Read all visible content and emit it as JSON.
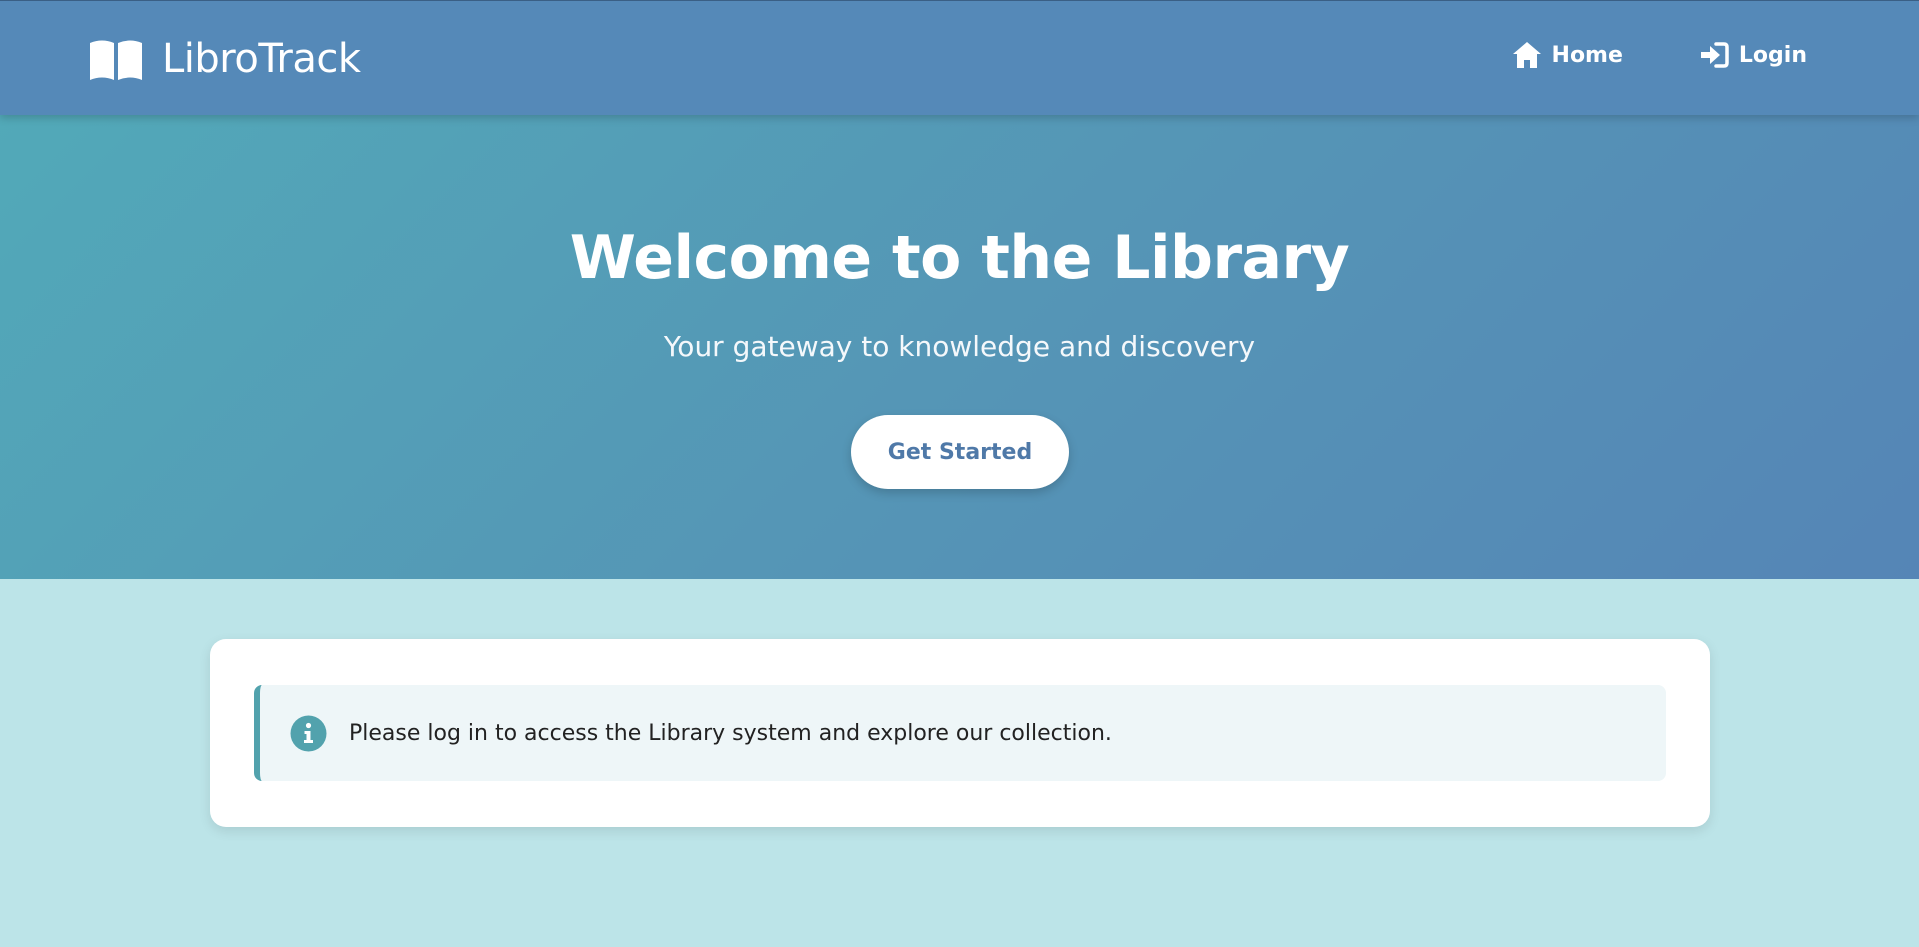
{
  "colors": {
    "navbar": "#5589b8",
    "hero_start": "#52a9b8",
    "hero_end": "#5585b6",
    "page_bg": "#bce4e8",
    "accent": "#52a2ad",
    "button_text": "#4f79a8"
  },
  "navbar": {
    "brand": {
      "icon": "open-book-icon",
      "name": "LibroTrack"
    },
    "links": [
      {
        "icon": "home-icon",
        "label": "Home"
      },
      {
        "icon": "login-icon",
        "label": "Login"
      }
    ]
  },
  "hero": {
    "title": "Welcome to the Library",
    "subtitle": "Your gateway to knowledge and discovery",
    "cta_label": "Get Started"
  },
  "notice": {
    "icon": "info-icon",
    "text": "Please log in to access the Library system and explore our collection."
  }
}
